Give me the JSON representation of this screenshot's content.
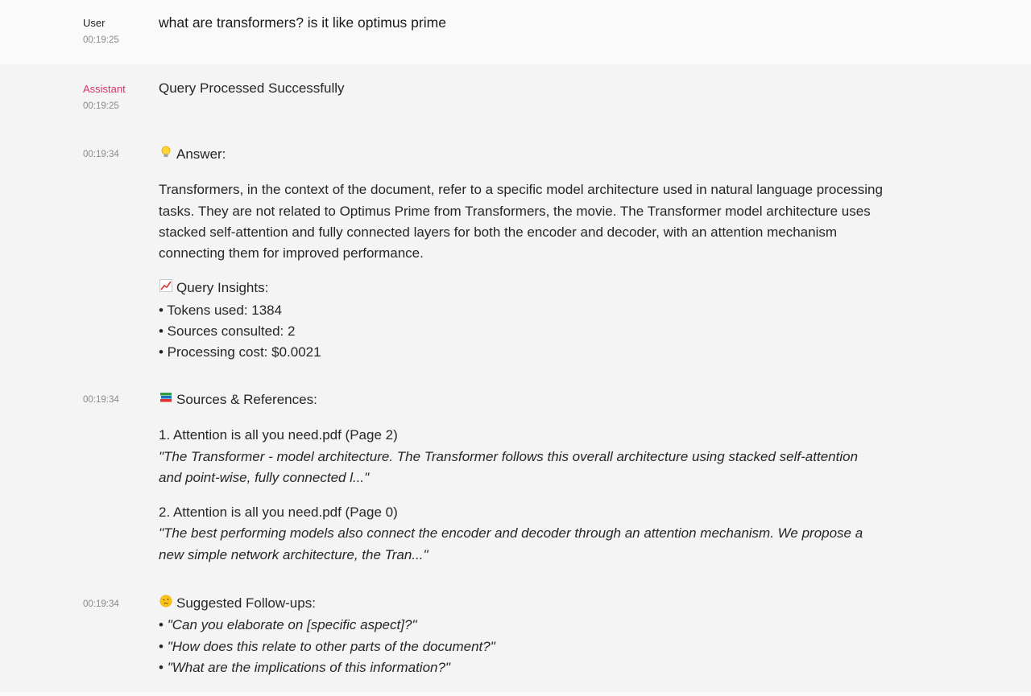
{
  "user_message": {
    "role": "User",
    "time": "00:19:25",
    "text": "what are transformers? is it like optimus prime"
  },
  "assistant": {
    "role": "Assistant",
    "time": "00:19:25",
    "status": "Query Processed Successfully"
  },
  "answer": {
    "time": "00:19:34",
    "icon": "lightbulb-icon",
    "heading": "Answer:",
    "body": "Transformers, in the context of the document, refer to a specific model architecture used in natural language processing tasks. They are not related to Optimus Prime from Transformers, the movie. The Transformer model architecture uses stacked self-attention and fully connected layers for both the encoder and decoder, with an attention mechanism connecting them for improved performance.",
    "insights_icon": "chart-increasing-icon",
    "insights_heading": "Query Insights:",
    "insights": [
      "• Tokens used: 1384",
      "• Sources consulted: 2",
      "• Processing cost: $0.0021"
    ]
  },
  "sources": {
    "time": "00:19:34",
    "icon": "books-icon",
    "heading": "Sources & References:",
    "items": [
      {
        "title": "1. Attention is all you need.pdf (Page 2)",
        "quote": "\"The Transformer - model architecture. The Transformer follows this overall architecture using stacked self-attention and point-wise, fully connected l...\""
      },
      {
        "title": "2. Attention is all you need.pdf (Page 0)",
        "quote": "\"The best performing models also connect the encoder and decoder through an attention mechanism. We propose a new simple network architecture, the Tran...\""
      }
    ]
  },
  "followups": {
    "time": "00:19:34",
    "icon": "thinking-face-icon",
    "heading": "Suggested Follow-ups:",
    "bullet": "•",
    "items": [
      "\"Can you elaborate on [specific aspect]?\"",
      "\"How does this relate to other parts of the document?\"",
      "\"What are the implications of this information?\""
    ]
  }
}
